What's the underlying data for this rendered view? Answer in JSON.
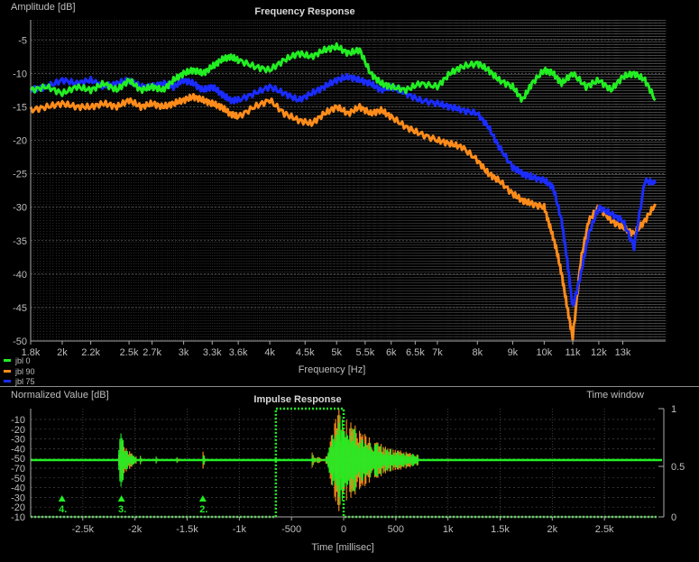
{
  "chart_data": [
    {
      "type": "line",
      "title": "Frequency Response",
      "ylabel": "Amplitude [dB]",
      "xlabel": "Frequency [Hz]",
      "xscale": "log",
      "xlim": [
        1800,
        15000
      ],
      "ylim": [
        -50,
        -2
      ],
      "yticks": [
        -5,
        -10,
        -15,
        -20,
        -25,
        -30,
        -35,
        -40,
        -45,
        -50
      ],
      "xticks": [
        {
          "v": 1800,
          "label": "1.8k"
        },
        {
          "v": 2000,
          "label": "2k"
        },
        {
          "v": 2200,
          "label": "2.2k"
        },
        {
          "v": 2500,
          "label": "2.5k"
        },
        {
          "v": 2700,
          "label": "2.7k"
        },
        {
          "v": 3000,
          "label": "3k"
        },
        {
          "v": 3300,
          "label": "3.3k"
        },
        {
          "v": 3600,
          "label": "3.6k"
        },
        {
          "v": 4000,
          "label": "4k"
        },
        {
          "v": 4500,
          "label": "4.5k"
        },
        {
          "v": 5000,
          "label": "5k"
        },
        {
          "v": 5500,
          "label": "5.5k"
        },
        {
          "v": 6000,
          "label": "6k"
        },
        {
          "v": 6500,
          "label": "6.5k"
        },
        {
          "v": 7000,
          "label": "7k"
        },
        {
          "v": 8000,
          "label": "8k"
        },
        {
          "v": 9000,
          "label": "9k"
        },
        {
          "v": 10000,
          "label": "10k"
        },
        {
          "v": 11000,
          "label": "11k"
        },
        {
          "v": 12000,
          "label": "12k"
        },
        {
          "v": 13000,
          "label": "13k"
        }
      ],
      "grid": true,
      "legend_position": "bottom-left",
      "series": [
        {
          "name": "jbl 0",
          "color": "#22ee22",
          "x": [
            1800,
            1900,
            2000,
            2100,
            2200,
            2300,
            2400,
            2500,
            2600,
            2700,
            2800,
            2900,
            3000,
            3100,
            3200,
            3300,
            3400,
            3500,
            3600,
            3800,
            4000,
            4200,
            4400,
            4600,
            4800,
            5000,
            5200,
            5400,
            5600,
            5800,
            6000,
            6300,
            6600,
            7000,
            7300,
            7600,
            8000,
            8300,
            8600,
            9000,
            9300,
            9600,
            10000,
            10300,
            10600,
            11000,
            11500,
            12000,
            12500,
            13000,
            13500,
            14000,
            14500
          ],
          "y": [
            -12.5,
            -12,
            -13,
            -12,
            -12.5,
            -11.5,
            -12.5,
            -11,
            -12.5,
            -12,
            -12.5,
            -11,
            -10,
            -9.5,
            -10,
            -9,
            -8,
            -7.5,
            -8,
            -9,
            -9.5,
            -8,
            -7,
            -7.5,
            -6.5,
            -6,
            -7,
            -6.5,
            -10,
            -11.5,
            -12,
            -12.5,
            -11.5,
            -12,
            -10,
            -9,
            -8.5,
            -9.5,
            -11,
            -12,
            -14,
            -11.5,
            -9.5,
            -10,
            -11.5,
            -10,
            -12,
            -11,
            -12.5,
            -10.5,
            -10,
            -11,
            -14
          ]
        },
        {
          "name": "jbl 90",
          "color": "#ff8c1a",
          "x": [
            1800,
            1900,
            2000,
            2100,
            2200,
            2300,
            2400,
            2500,
            2600,
            2700,
            2800,
            2900,
            3000,
            3100,
            3200,
            3300,
            3400,
            3500,
            3600,
            3800,
            4000,
            4200,
            4400,
            4600,
            4800,
            5000,
            5200,
            5400,
            5600,
            5800,
            6000,
            6300,
            6600,
            7000,
            7300,
            7600,
            8000,
            8300,
            8600,
            9000,
            9300,
            9600,
            10000,
            10200,
            10400,
            10600,
            10800,
            11000,
            11300,
            11600,
            12000,
            12500,
            13000,
            13500,
            14000,
            14500
          ],
          "y": [
            -15.5,
            -15,
            -14.5,
            -15,
            -15,
            -14.5,
            -15,
            -14,
            -15,
            -14.5,
            -15,
            -14.5,
            -14,
            -13.5,
            -14,
            -14.5,
            -15,
            -16,
            -16.5,
            -15,
            -14,
            -16,
            -17,
            -17.5,
            -16,
            -15,
            -16,
            -15,
            -16,
            -15.5,
            -16.5,
            -18,
            -19,
            -20,
            -20.5,
            -21,
            -23,
            -25,
            -26,
            -28,
            -29,
            -29.5,
            -30,
            -33,
            -36,
            -40,
            -45,
            -49.5,
            -38,
            -32,
            -30,
            -32,
            -33,
            -34,
            -32,
            -29.5
          ]
        },
        {
          "name": "jbl 75",
          "color": "#1a2cff",
          "x": [
            1800,
            1900,
            2000,
            2100,
            2200,
            2300,
            2400,
            2500,
            2600,
            2700,
            2800,
            2900,
            3000,
            3100,
            3200,
            3300,
            3400,
            3500,
            3600,
            3800,
            4000,
            4200,
            4400,
            4600,
            4800,
            5000,
            5200,
            5400,
            5600,
            5800,
            6000,
            6300,
            6600,
            7000,
            7300,
            7600,
            8000,
            8300,
            8600,
            9000,
            9300,
            9600,
            10000,
            10300,
            10600,
            10800,
            11000,
            11300,
            11600,
            12000,
            12500,
            13000,
            13500,
            14000,
            14500
          ],
          "y": [
            -12.5,
            -12,
            -11,
            -11.5,
            -11,
            -12,
            -11.5,
            -11,
            -12,
            -12,
            -11.5,
            -12,
            -11,
            -11.5,
            -12.5,
            -12,
            -13,
            -14,
            -14,
            -13,
            -12,
            -13,
            -14,
            -13,
            -12,
            -11,
            -10.5,
            -11,
            -11.5,
            -12.5,
            -12,
            -13,
            -14,
            -14.5,
            -15,
            -15.5,
            -16,
            -18,
            -21,
            -24,
            -25,
            -25.5,
            -26,
            -27,
            -32,
            -38,
            -45,
            -40,
            -34,
            -30,
            -31,
            -32,
            -36,
            -26,
            -26.5
          ]
        }
      ]
    },
    {
      "type": "line",
      "title": "Impulse Response",
      "ylabel": "Normalized Value [dB]",
      "xlabel": "Time [millisec]",
      "right_label": "Time window",
      "xlim": [
        -3000,
        3000
      ],
      "ylim": [
        -100,
        0
      ],
      "yticks": [
        -10,
        -20,
        -30,
        -40,
        -50,
        -70,
        -50,
        -40,
        -30,
        -20,
        -10
      ],
      "xticks": [
        {
          "v": -2500,
          "label": "-2.5k"
        },
        {
          "v": -2000,
          "label": "-2k"
        },
        {
          "v": -1500,
          "label": "-1.5k"
        },
        {
          "v": -1000,
          "label": "-1k"
        },
        {
          "v": -500,
          "label": "-500"
        },
        {
          "v": 0,
          "label": "0"
        },
        {
          "v": 500,
          "label": "500"
        },
        {
          "v": 1000,
          "label": "1k"
        },
        {
          "v": 1500,
          "label": "1.5k"
        },
        {
          "v": 2000,
          "label": "2k"
        },
        {
          "v": 2500,
          "label": "2.5k"
        }
      ],
      "right_ticks": [
        "1",
        "0.5",
        "0"
      ],
      "time_window": {
        "start_ms": -650,
        "end_ms": 0,
        "level": 1
      },
      "markers": [
        {
          "label": "4.",
          "x_ms": -2700
        },
        {
          "label": "3.",
          "x_ms": -2130
        },
        {
          "label": "2.",
          "x_ms": -1350
        }
      ],
      "bursts": [
        {
          "center_ms": -2130,
          "width_ms": 180,
          "amp": 0.62
        },
        {
          "center_ms": -1350,
          "width_ms": 40,
          "amp": 0.28
        },
        {
          "center_ms": -1950,
          "width_ms": 40,
          "amp": 0.12
        },
        {
          "center_ms": -1800,
          "width_ms": 40,
          "amp": 0.14
        },
        {
          "center_ms": -1600,
          "width_ms": 40,
          "amp": 0.1
        },
        {
          "center_ms": -250,
          "width_ms": 60,
          "amp": 0.12
        },
        {
          "center_ms": -300,
          "width_ms": 60,
          "amp": 0.18
        },
        {
          "center_ms": 0,
          "width_ms": 900,
          "amp": 1.0
        },
        {
          "center_ms": 1000,
          "width_ms": 40,
          "amp": 0.04
        }
      ],
      "colors": {
        "main": "#22ee22",
        "secondary": "#ff8c1a",
        "tertiary": "#1a2cff",
        "window": "#22ee22"
      }
    }
  ]
}
